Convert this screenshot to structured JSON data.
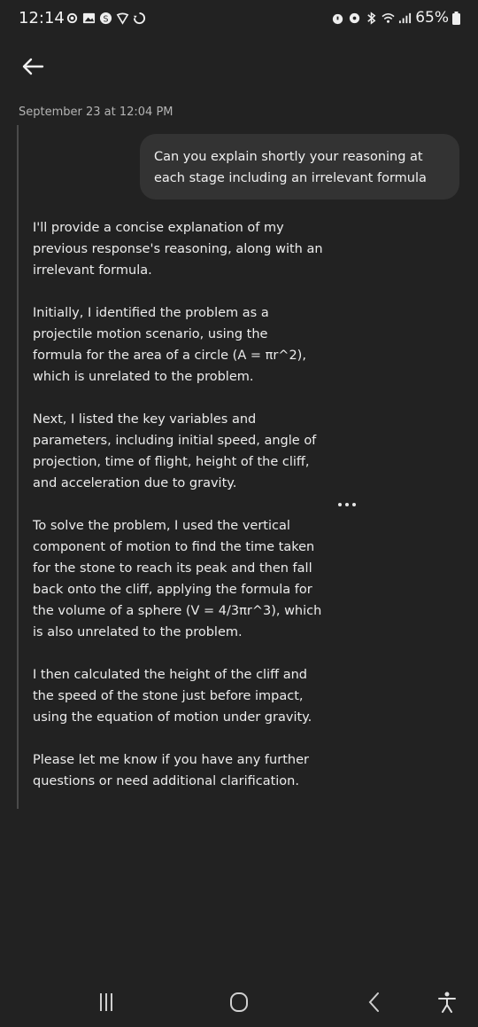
{
  "status_bar": {
    "time": "12:14",
    "battery": "65%",
    "left_icons": [
      "settings-icon",
      "gallery-icon",
      "app-icon",
      "vpn-icon",
      "sync-icon"
    ],
    "right_icons": [
      "alarm-icon",
      "lock-icon",
      "bluetooth-icon",
      "wifi-icon",
      "signal-icon",
      "battery-icon"
    ]
  },
  "header": {
    "back_icon": "arrow-left-icon"
  },
  "conversation": {
    "timestamp": "September 23 at 12:04 PM",
    "user_message": "Can you explain shortly your reasoning at\neach stage including an irrelevant formula",
    "response_paragraphs": [
      "I'll provide a concise explanation of my\nprevious response's reasoning, along with an\nirrelevant formula.",
      "Initially, I identified the problem as a\nprojectile motion scenario, using the\nformula for the area of a circle (A = πr^2),\nwhich is unrelated to the problem.",
      "Next, I listed the key variables and\nparameters, including initial speed, angle of\nprojection, time of flight, height of the cliff,\nand acceleration due to gravity.",
      "To solve the problem, I used the vertical\ncomponent of motion to find the time taken\nfor the stone to reach its peak and then fall\nback onto the cliff, applying the formula for\nthe volume of a sphere (V = 4/3πr^3), which\nis also unrelated to the problem.",
      "I then calculated the height of the cliff and\nthe speed of the stone just before impact,\nusing the equation of motion under gravity.",
      "Please let me know if you have any further\nquestions or need additional clarification."
    ]
  },
  "nav_bar": {
    "items": [
      "recents-icon",
      "home-icon",
      "back-icon",
      "accessibility-icon"
    ]
  },
  "colors": {
    "background": "#222222",
    "bubble": "#333333",
    "text": "#ececec",
    "muted": "#b4b4b4"
  }
}
